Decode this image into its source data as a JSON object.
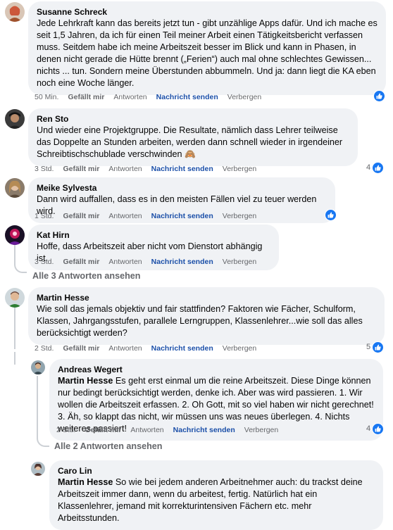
{
  "common": {
    "like": "Gefällt mir",
    "reply": "Antworten",
    "message": "Nachricht senden",
    "hide": "Verbergen"
  },
  "comments": [
    {
      "author": "Susanne Schreck",
      "text": "Jede Lehrkraft kann das bereits jetzt tun - gibt unzählige Apps dafür. Und ich mache es seit 1,5 Jahren, da ich für einen Teil meiner Arbeit einen Tätigkeitsbericht verfassen muss. Seitdem habe ich meine Arbeitszeit besser im Blick und kann in Phasen, in denen nicht gerade die Hütte brennt („Ferien“) auch mal ohne schlechtes Gewissen... nichts ... tun. Sondern meine Überstunden abbummeln. Und ja: dann liegt die KA eben noch eine Woche länger.",
      "time": "50 Min.",
      "reactions": ""
    },
    {
      "author": "Ren Sto",
      "text": "Und wieder eine Projektgruppe. Die Resultate, nämlich dass Lehrer teilweise das Doppelte an Stunden arbeiten, werden dann schnell wieder in irgendeiner Schreibtischschublade verschwinden 🙈",
      "time": "3 Std.",
      "reactions": "4"
    },
    {
      "author": "Meike Sylvesta",
      "text": "Dann wird auffallen, dass es in den meisten Fällen viel zu teuer werden wird.",
      "time": "1 Std.",
      "reactions": ""
    },
    {
      "author": "Kat Hirn",
      "text": "Hoffe, dass Arbeitszeit aber nicht vom Dienstort abhängig ist.",
      "time": "3 Std.",
      "reactions": ""
    },
    {
      "author": "Martin Hesse",
      "text": "Wie soll das jemals objektiv und fair stattfinden? Faktoren wie Fächer, Schulform, Klassen, Jahrgangsstufen, parallele Lerngruppen, Klassenlehrer...wie soll das alles berücksichtigt werden?",
      "time": "2 Std.",
      "reactions": "5"
    }
  ],
  "replies": [
    {
      "author": "Andreas Wegert",
      "mention": "Martin Hesse",
      "text": " Es geht erst einmal um die reine Arbeitszeit. Diese Dinge können nur bedingt berücksichtigt werden, denke ich. Aber was wird passieren. 1. Wir wollen die Arbeitszeit erfassen. 2. Oh Gott, mit so viel haben wir nicht gerechnet! 3. Äh, so klappt das nicht, wir müssen uns was neues überlegen. 4. Nichts weiteres passiert!",
      "time": "2 Std.",
      "reactions": "4"
    },
    {
      "author": "Caro Lin",
      "mention": "Martin Hesse",
      "text": " So wie bei jedem anderen Arbeitnehmer auch: du trackst deine Arbeitszeit immer dann, wenn du arbeitest, fertig. Natürlich hat ein Klassenlehrer, jemand mit korrekturintensiven Fächern etc. mehr Arbeitsstunden."
    }
  ],
  "view_more": {
    "all3": "Alle 3 Antworten ansehen",
    "all2": "Alle 2 Antworten ansehen"
  },
  "colors": {
    "bubble": "#f0f2f5",
    "meta": "#65676b",
    "message_link": "#1b4fa8",
    "like_badge": "#1877f2",
    "thread_line": "#ccd0d5"
  },
  "icons": {
    "like_badge": "thumbs-up-icon"
  }
}
